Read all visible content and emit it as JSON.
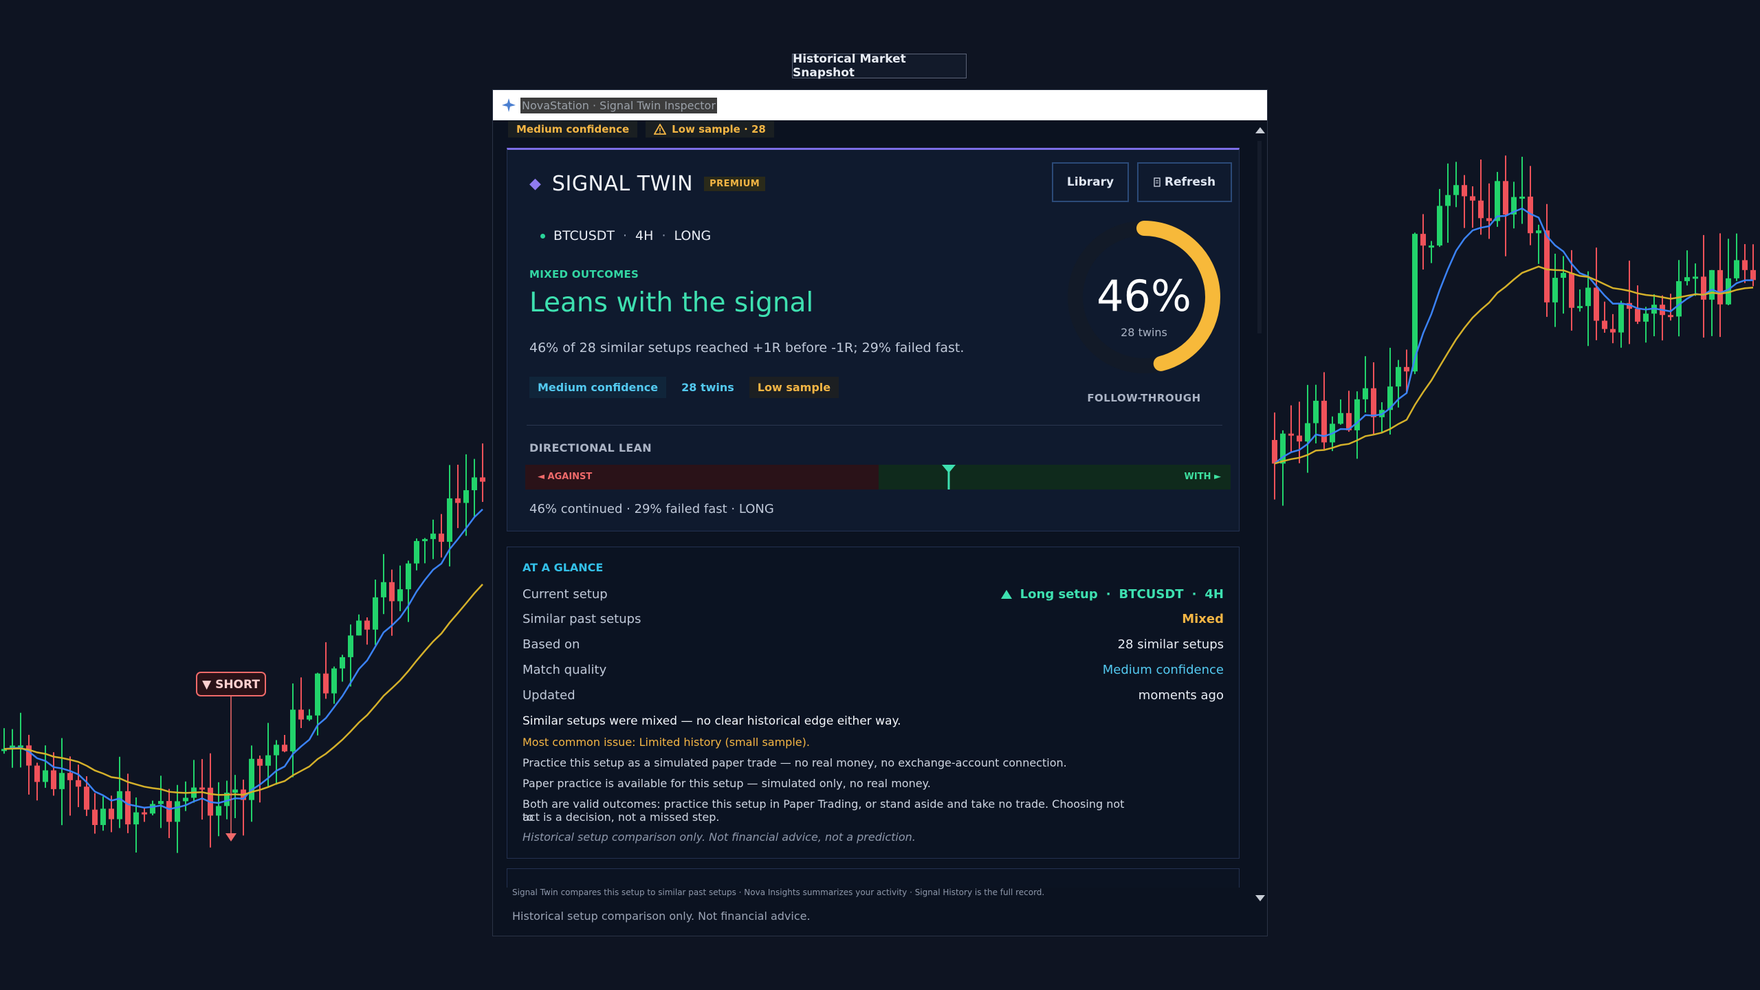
{
  "snapshot_label": "Historical Market Snapshot",
  "window": {
    "title": "NovaStation · Signal Twin Inspector",
    "top_badges": {
      "confidence": "Medium confidence",
      "sample": "Low sample · 28"
    }
  },
  "card": {
    "title": "SIGNAL TWIN",
    "badge": "PREMIUM",
    "buttons": {
      "library": "Library",
      "refresh": "Refresh"
    },
    "symbol": "BTCUSDT",
    "timeframe": "4H",
    "direction": "LONG",
    "outcome_tag": "MIXED OUTCOMES",
    "headline": "Leans with the signal",
    "summary": "46% of 28 similar setups reached +1R before -1R; 29% failed fast.",
    "chips": {
      "confidence": "Medium confidence",
      "twins": "28 twins",
      "sample": "Low sample"
    },
    "ring": {
      "percent_label": "46%",
      "sub": "28 twins",
      "caption": "FOLLOW-THROUGH",
      "value": 0.46
    },
    "lean": {
      "heading": "DIRECTIONAL LEAN",
      "against_label": "◄ AGAINST",
      "with_label": "WITH ►",
      "marker_position": 0.6,
      "footer": "46% continued · 29% failed fast · LONG"
    }
  },
  "glance": {
    "heading": "AT A GLANCE",
    "rows": {
      "current_setup": {
        "label": "Current setup",
        "value": "Long setup",
        "symbol": "BTCUSDT",
        "tf": "4H"
      },
      "similar": {
        "label": "Similar past setups",
        "value": "Mixed"
      },
      "based_on": {
        "label": "Based on",
        "value": "28 similar setups"
      },
      "match": {
        "label": "Match quality",
        "value": "Medium confidence"
      },
      "updated": {
        "label": "Updated",
        "value": "moments ago"
      }
    },
    "lines": {
      "mixed": "Similar setups were mixed — no clear historical edge either way.",
      "issue": "Most common issue:  Limited history (small sample).",
      "practice": "Practice this setup as a simulated paper trade — no real money, no exchange-account connection.",
      "paper": "Paper practice is available for this setup — simulated only, no real money.",
      "valid1": "Both are valid outcomes: practice this setup in Paper Trading, or stand aside and take no trade. Choosing not to",
      "valid2": "act is a decision, not a missed step.",
      "disclaimer": "Historical setup comparison only. Not financial advice, not a prediction."
    }
  },
  "footer": {
    "line1": "Signal Twin compares this setup to similar past setups · Nova Insights summarizes your activity · Signal History is the full record.",
    "line2": "Historical setup comparison only. Not financial advice."
  },
  "chart": {
    "short_label": "▼ SHORT",
    "colors": {
      "up": "#22d36b",
      "down": "#f0525a",
      "ema_fast": "#3b82f6",
      "ema_slow": "#d4b02a",
      "bg": "#0e1422"
    }
  }
}
